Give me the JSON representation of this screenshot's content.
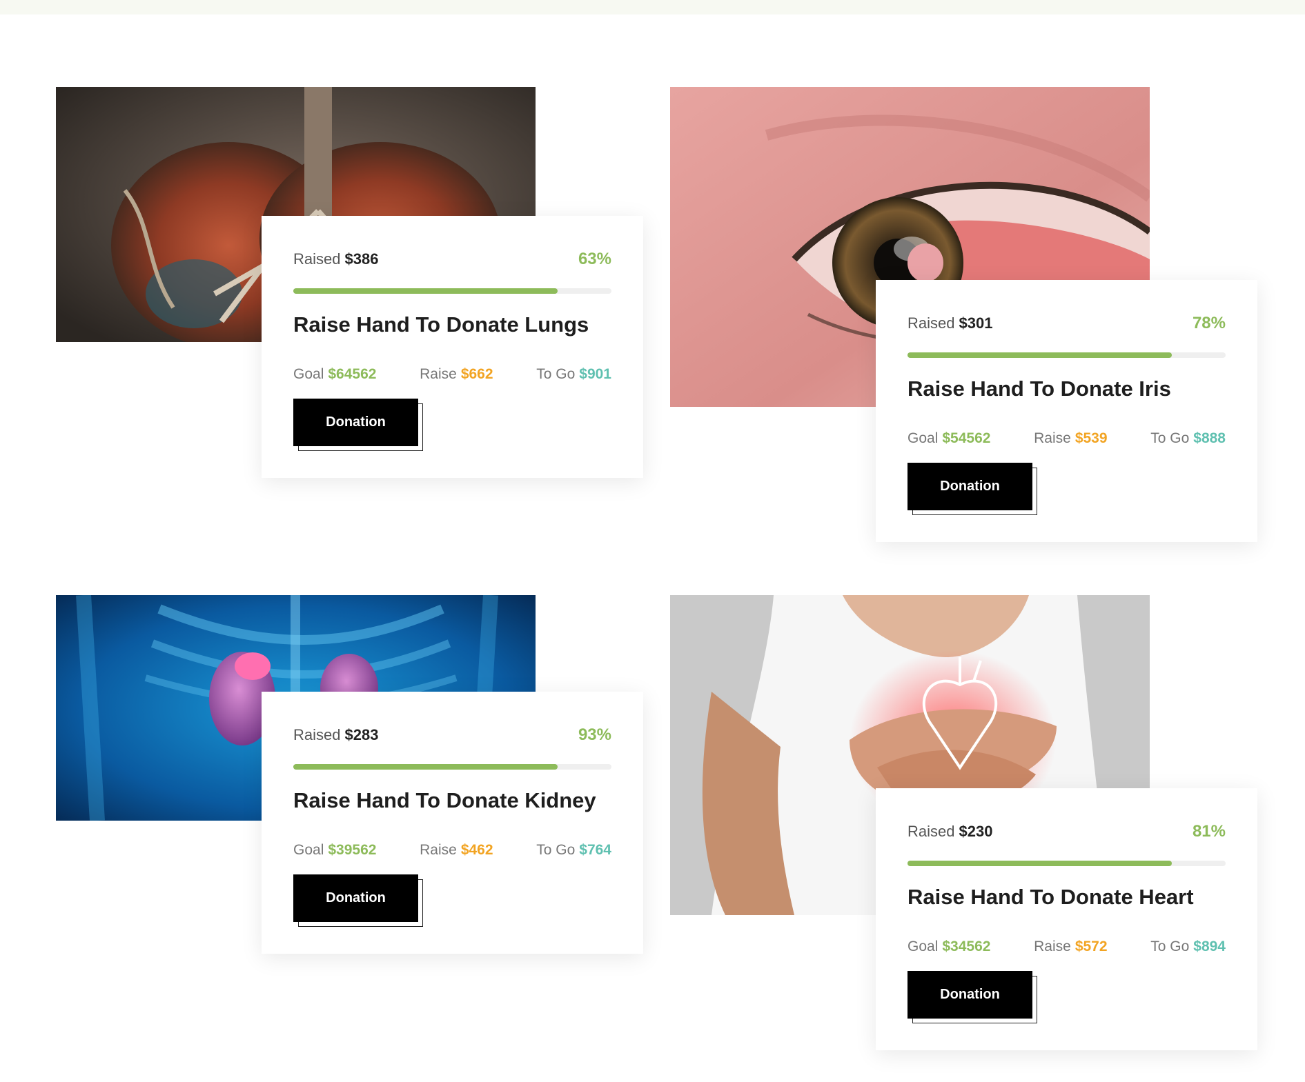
{
  "colors": {
    "accent_green": "#8dbb5a",
    "raise_orange": "#f2a423",
    "togo_teal": "#5fc0b0",
    "button_black": "#000000"
  },
  "labels": {
    "raised": "Raised",
    "goal": "Goal",
    "raise": "Raise",
    "to_go": "To Go"
  },
  "campaigns": [
    {
      "image": "lungs-image",
      "raised": "$386",
      "percent": "63%",
      "progress": 0.83,
      "title": "Raise Hand To Donate Lungs",
      "goal": "$64562",
      "raise": "$662",
      "to_go": "$901",
      "button": "Donation"
    },
    {
      "image": "eye-image",
      "raised": "$301",
      "percent": "78%",
      "progress": 0.83,
      "title": "Raise Hand To Donate Iris",
      "goal": "$54562",
      "raise": "$539",
      "to_go": "$888",
      "button": "Donation"
    },
    {
      "image": "kidney-image",
      "raised": "$283",
      "percent": "93%",
      "progress": 0.83,
      "title": "Raise Hand To Donate Kidney",
      "goal": "$39562",
      "raise": "$462",
      "to_go": "$764",
      "button": "Donation"
    },
    {
      "image": "heart-image",
      "raised": "$230",
      "percent": "81%",
      "progress": 0.83,
      "title": "Raise Hand To Donate Heart",
      "goal": "$34562",
      "raise": "$572",
      "to_go": "$894",
      "button": "Donation"
    }
  ]
}
